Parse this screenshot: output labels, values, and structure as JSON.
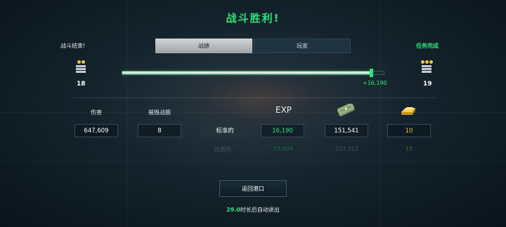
{
  "header": {
    "title": "战斗胜利!",
    "battle_end": "战斗结束!",
    "mission_complete": "任务完成"
  },
  "tabs": [
    {
      "label": "战绩",
      "active": true
    },
    {
      "label": "玩家",
      "active": false
    }
  ],
  "progress": {
    "level_current": "18",
    "level_next": "19",
    "xp_gain": "+16,190",
    "fill_fraction": 0.955
  },
  "stats": {
    "damage_label": "伤害",
    "damage_value": "647,609",
    "kills_label": "摧毁战舰",
    "kills_value": "8"
  },
  "rewards": {
    "exp_header": "EXP",
    "standard_label": "标准的",
    "standard_exp": "16,190",
    "standard_credits": "151,541",
    "standard_gold": "10",
    "premium_label": "优质的",
    "premium_exp": "17,809",
    "premium_credits": "227,312",
    "premium_gold": "15",
    "credits_icon": "money-stack-icon",
    "gold_icon": "gold-bar-icon"
  },
  "footer": {
    "return_label": "返回港口",
    "countdown": "29.0",
    "countdown_suffix": "时长后自动退出"
  },
  "colors": {
    "accent_green": "#2ee57a",
    "gold": "#f0c03c",
    "background": "#14232c"
  }
}
